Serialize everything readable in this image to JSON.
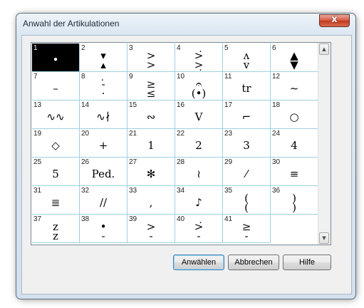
{
  "window": {
    "title": "Anwahl der Artikulationen",
    "close_glyph": "x"
  },
  "articulations": [
    {
      "number": "1",
      "symbol": "•",
      "selected": true
    },
    {
      "number": "2",
      "symbol": "▾\n▴"
    },
    {
      "number": "3",
      "symbol": ">\n>"
    },
    {
      "number": "4",
      "symbol": ">̇\n>̣"
    },
    {
      "number": "5",
      "symbol": "ʌ\nv"
    },
    {
      "number": "6",
      "symbol": "▲\n▼"
    },
    {
      "number": "7",
      "symbol": "–"
    },
    {
      "number": "8",
      "symbol": "-̇\n·"
    },
    {
      "number": "9",
      "symbol": "≥\n≤"
    },
    {
      "number": "10",
      "symbol": "𝄐\n(•)"
    },
    {
      "number": "11",
      "symbol": "tr"
    },
    {
      "number": "12",
      "symbol": "~"
    },
    {
      "number": "13",
      "symbol": "∿∿"
    },
    {
      "number": "14",
      "symbol": "∿∤"
    },
    {
      "number": "15",
      "symbol": "∾"
    },
    {
      "number": "16",
      "symbol": "V"
    },
    {
      "number": "17",
      "symbol": "⌐"
    },
    {
      "number": "18",
      "symbol": "○"
    },
    {
      "number": "19",
      "symbol": "◇"
    },
    {
      "number": "20",
      "symbol": "+"
    },
    {
      "number": "21",
      "symbol": "1"
    },
    {
      "number": "22",
      "symbol": "2"
    },
    {
      "number": "23",
      "symbol": "3"
    },
    {
      "number": "24",
      "symbol": "4"
    },
    {
      "number": "25",
      "symbol": "5"
    },
    {
      "number": "26",
      "symbol": "Ped."
    },
    {
      "number": "27",
      "symbol": "✻"
    },
    {
      "number": "28",
      "symbol": "≀"
    },
    {
      "number": "29",
      "symbol": "⁄"
    },
    {
      "number": "30",
      "symbol": "≡"
    },
    {
      "number": "31",
      "symbol": "≣"
    },
    {
      "number": "32",
      "symbol": "//"
    },
    {
      "number": "33",
      "symbol": ","
    },
    {
      "number": "34",
      "symbol": "♪"
    },
    {
      "number": "35",
      "symbol": "(\n("
    },
    {
      "number": "36",
      "symbol": ")\n)"
    },
    {
      "number": "37",
      "symbol": "z\nz"
    },
    {
      "number": "38",
      "symbol": "•\n-"
    },
    {
      "number": "39",
      "symbol": ">\n-"
    },
    {
      "number": "40",
      "symbol": ">̇\n-"
    },
    {
      "number": "41",
      "symbol": "≥\n-"
    },
    {
      "number": "",
      "symbol": ""
    }
  ],
  "scrollbar": {
    "up_glyph": "▲",
    "down_glyph": "▼"
  },
  "buttons": {
    "select": "Anwählen",
    "cancel": "Abbrechen",
    "help": "Hilfe"
  }
}
